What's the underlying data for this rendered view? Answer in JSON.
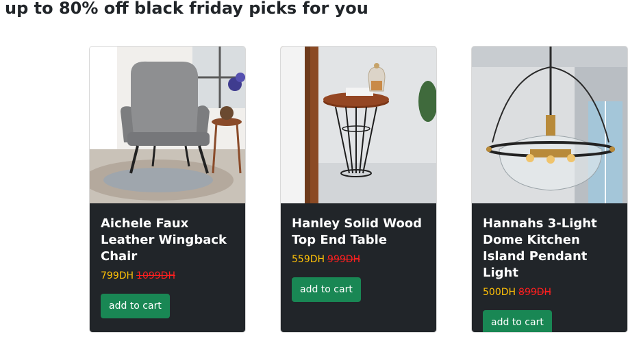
{
  "header": {
    "title": "up to 80% off black friday picks for you"
  },
  "products": [
    {
      "name": "Aichele Faux Leather Wingback Chair",
      "price": "799DH",
      "old_price": "1099DH",
      "button_label": "add to cart"
    },
    {
      "name": "Hanley Solid Wood Top End Table",
      "price": "559DH",
      "old_price": "999DH",
      "button_label": "add to cart"
    },
    {
      "name": "Hannahs 3-Light Dome Kitchen Island Pendant Light",
      "price": "500DH",
      "old_price": "899DH",
      "button_label": "add to cart"
    }
  ],
  "colors": {
    "card_bg": "#212529",
    "price": "#ffc107",
    "old_price": "#ff1f1f",
    "button": "#198754"
  }
}
